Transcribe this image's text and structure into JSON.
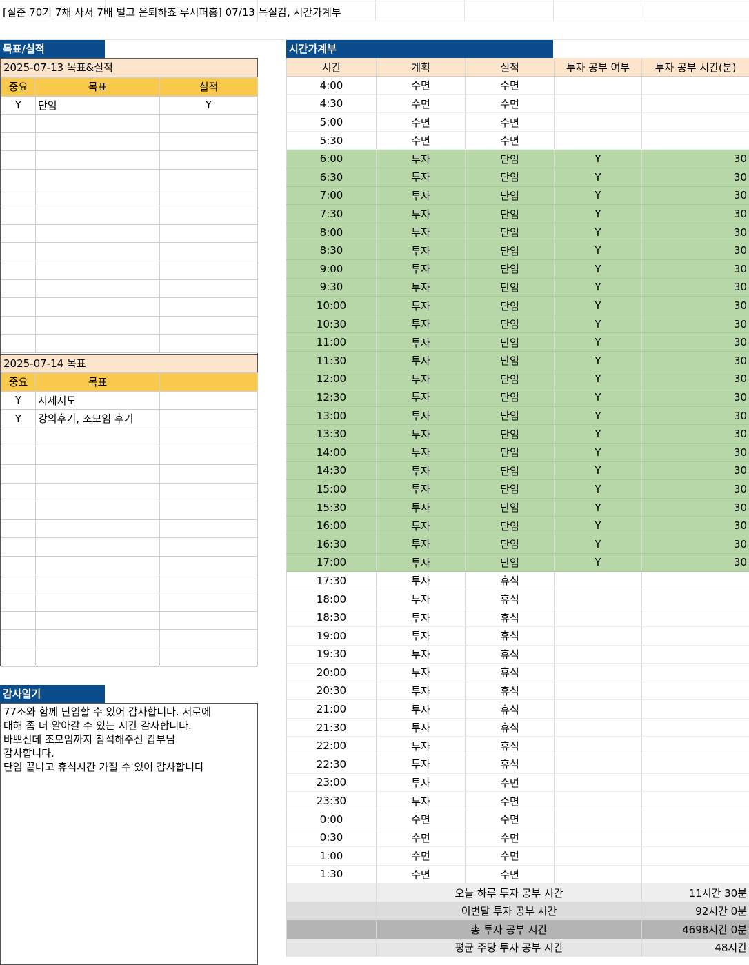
{
  "sheet_title": "[실준 70기 7채 사서 7배 벌고 은퇴하죠 루시퍼홍] 07/13 목실감, 시간가계부",
  "goals_section": {
    "header": "목표/실적",
    "day1": {
      "title": "2025-07-13 목표&실적",
      "columns": [
        "중요",
        "목표",
        "실적"
      ],
      "rows": [
        {
          "priority": "Y",
          "goal": "단임",
          "result": "Y"
        },
        {
          "priority": "",
          "goal": "",
          "result": ""
        },
        {
          "priority": "",
          "goal": "",
          "result": ""
        },
        {
          "priority": "",
          "goal": "",
          "result": ""
        },
        {
          "priority": "",
          "goal": "",
          "result": ""
        },
        {
          "priority": "",
          "goal": "",
          "result": ""
        },
        {
          "priority": "",
          "goal": "",
          "result": ""
        },
        {
          "priority": "",
          "goal": "",
          "result": ""
        },
        {
          "priority": "",
          "goal": "",
          "result": ""
        },
        {
          "priority": "",
          "goal": "",
          "result": ""
        },
        {
          "priority": "",
          "goal": "",
          "result": ""
        },
        {
          "priority": "",
          "goal": "",
          "result": ""
        },
        {
          "priority": "",
          "goal": "",
          "result": ""
        },
        {
          "priority": "",
          "goal": "",
          "result": ""
        }
      ]
    },
    "day2": {
      "title": "2025-07-14 목표",
      "columns": [
        "중요",
        "목표",
        ""
      ],
      "rows": [
        {
          "priority": "Y",
          "goal": "시세지도",
          "result": ""
        },
        {
          "priority": "Y",
          "goal": "강의후기, 조모임 후기",
          "result": ""
        },
        {
          "priority": "",
          "goal": "",
          "result": ""
        },
        {
          "priority": "",
          "goal": "",
          "result": ""
        },
        {
          "priority": "",
          "goal": "",
          "result": ""
        },
        {
          "priority": "",
          "goal": "",
          "result": ""
        },
        {
          "priority": "",
          "goal": "",
          "result": ""
        },
        {
          "priority": "",
          "goal": "",
          "result": ""
        },
        {
          "priority": "",
          "goal": "",
          "result": ""
        },
        {
          "priority": "",
          "goal": "",
          "result": ""
        },
        {
          "priority": "",
          "goal": "",
          "result": ""
        },
        {
          "priority": "",
          "goal": "",
          "result": ""
        },
        {
          "priority": "",
          "goal": "",
          "result": ""
        },
        {
          "priority": "",
          "goal": "",
          "result": ""
        },
        {
          "priority": "",
          "goal": "",
          "result": ""
        }
      ]
    }
  },
  "gratitude": {
    "header": "감사일기",
    "text": "77조와 함께 단임할 수 있어 감사합니다. 서로에\n대해 좀 더 알아갈 수 있는 시간 감사합니다.\n바쁘신데 조모임까지 참석해주신 갑부님\n감사합니다.\n단임 끝나고 휴식시간 가질 수 있어 감사합니다"
  },
  "timebook": {
    "header": "시간가계부",
    "columns": [
      "시간",
      "계획",
      "실적",
      "투자 공부 여부",
      "투자 공부 시간(분)"
    ],
    "rows": [
      {
        "time": "4:00",
        "plan": "수면",
        "actual": "수면",
        "study": "",
        "minutes": ""
      },
      {
        "time": "4:30",
        "plan": "수면",
        "actual": "수면",
        "study": "",
        "minutes": ""
      },
      {
        "time": "5:00",
        "plan": "수면",
        "actual": "수면",
        "study": "",
        "minutes": ""
      },
      {
        "time": "5:30",
        "plan": "수면",
        "actual": "수면",
        "study": "",
        "minutes": ""
      },
      {
        "time": "6:00",
        "plan": "투자",
        "actual": "단임",
        "study": "Y",
        "minutes": "30"
      },
      {
        "time": "6:30",
        "plan": "투자",
        "actual": "단임",
        "study": "Y",
        "minutes": "30"
      },
      {
        "time": "7:00",
        "plan": "투자",
        "actual": "단임",
        "study": "Y",
        "minutes": "30"
      },
      {
        "time": "7:30",
        "plan": "투자",
        "actual": "단임",
        "study": "Y",
        "minutes": "30"
      },
      {
        "time": "8:00",
        "plan": "투자",
        "actual": "단임",
        "study": "Y",
        "minutes": "30"
      },
      {
        "time": "8:30",
        "plan": "투자",
        "actual": "단임",
        "study": "Y",
        "minutes": "30"
      },
      {
        "time": "9:00",
        "plan": "투자",
        "actual": "단임",
        "study": "Y",
        "minutes": "30"
      },
      {
        "time": "9:30",
        "plan": "투자",
        "actual": "단임",
        "study": "Y",
        "minutes": "30"
      },
      {
        "time": "10:00",
        "plan": "투자",
        "actual": "단임",
        "study": "Y",
        "minutes": "30"
      },
      {
        "time": "10:30",
        "plan": "투자",
        "actual": "단임",
        "study": "Y",
        "minutes": "30"
      },
      {
        "time": "11:00",
        "plan": "투자",
        "actual": "단임",
        "study": "Y",
        "minutes": "30"
      },
      {
        "time": "11:30",
        "plan": "투자",
        "actual": "단임",
        "study": "Y",
        "minutes": "30"
      },
      {
        "time": "12:00",
        "plan": "투자",
        "actual": "단임",
        "study": "Y",
        "minutes": "30"
      },
      {
        "time": "12:30",
        "plan": "투자",
        "actual": "단임",
        "study": "Y",
        "minutes": "30"
      },
      {
        "time": "13:00",
        "plan": "투자",
        "actual": "단임",
        "study": "Y",
        "minutes": "30"
      },
      {
        "time": "13:30",
        "plan": "투자",
        "actual": "단임",
        "study": "Y",
        "minutes": "30"
      },
      {
        "time": "14:00",
        "plan": "투자",
        "actual": "단임",
        "study": "Y",
        "minutes": "30"
      },
      {
        "time": "14:30",
        "plan": "투자",
        "actual": "단임",
        "study": "Y",
        "minutes": "30"
      },
      {
        "time": "15:00",
        "plan": "투자",
        "actual": "단임",
        "study": "Y",
        "minutes": "30"
      },
      {
        "time": "15:30",
        "plan": "투자",
        "actual": "단임",
        "study": "Y",
        "minutes": "30"
      },
      {
        "time": "16:00",
        "plan": "투자",
        "actual": "단임",
        "study": "Y",
        "minutes": "30"
      },
      {
        "time": "16:30",
        "plan": "투자",
        "actual": "단임",
        "study": "Y",
        "minutes": "30"
      },
      {
        "time": "17:00",
        "plan": "투자",
        "actual": "단임",
        "study": "Y",
        "minutes": "30"
      },
      {
        "time": "17:30",
        "plan": "투자",
        "actual": "휴식",
        "study": "",
        "minutes": ""
      },
      {
        "time": "18:00",
        "plan": "투자",
        "actual": "휴식",
        "study": "",
        "minutes": ""
      },
      {
        "time": "18:30",
        "plan": "투자",
        "actual": "휴식",
        "study": "",
        "minutes": ""
      },
      {
        "time": "19:00",
        "plan": "투자",
        "actual": "휴식",
        "study": "",
        "minutes": ""
      },
      {
        "time": "19:30",
        "plan": "투자",
        "actual": "휴식",
        "study": "",
        "minutes": ""
      },
      {
        "time": "20:00",
        "plan": "투자",
        "actual": "휴식",
        "study": "",
        "minutes": ""
      },
      {
        "time": "20:30",
        "plan": "투자",
        "actual": "휴식",
        "study": "",
        "minutes": ""
      },
      {
        "time": "21:00",
        "plan": "투자",
        "actual": "휴식",
        "study": "",
        "minutes": ""
      },
      {
        "time": "21:30",
        "plan": "투자",
        "actual": "휴식",
        "study": "",
        "minutes": ""
      },
      {
        "time": "22:00",
        "plan": "투자",
        "actual": "휴식",
        "study": "",
        "minutes": ""
      },
      {
        "time": "22:30",
        "plan": "투자",
        "actual": "휴식",
        "study": "",
        "minutes": ""
      },
      {
        "time": "23:00",
        "plan": "투자",
        "actual": "수면",
        "study": "",
        "minutes": ""
      },
      {
        "time": "23:30",
        "plan": "투자",
        "actual": "수면",
        "study": "",
        "minutes": ""
      },
      {
        "time": "0:00",
        "plan": "수면",
        "actual": "수면",
        "study": "",
        "minutes": ""
      },
      {
        "time": "0:30",
        "plan": "수면",
        "actual": "수면",
        "study": "",
        "minutes": ""
      },
      {
        "time": "1:00",
        "plan": "수면",
        "actual": "수면",
        "study": "",
        "minutes": ""
      },
      {
        "time": "1:30",
        "plan": "수면",
        "actual": "수면",
        "study": "",
        "minutes": ""
      }
    ],
    "summary": [
      {
        "label": "오늘 하루 투자 공부 시간",
        "value": "11시간 30분"
      },
      {
        "label": "이번달 투자 공부 시간",
        "value": "92시간 0분"
      },
      {
        "label": "총 투자 공부 시간",
        "value": "4698시간 0분"
      },
      {
        "label": "평균 주당 투자 공부 시간",
        "value": "48시간"
      }
    ]
  },
  "colors": {
    "section_header": "#0b4c8c",
    "peach_header": "#fde4cc",
    "gold_header": "#f8c94c",
    "study_row": "#b7d7a8"
  }
}
